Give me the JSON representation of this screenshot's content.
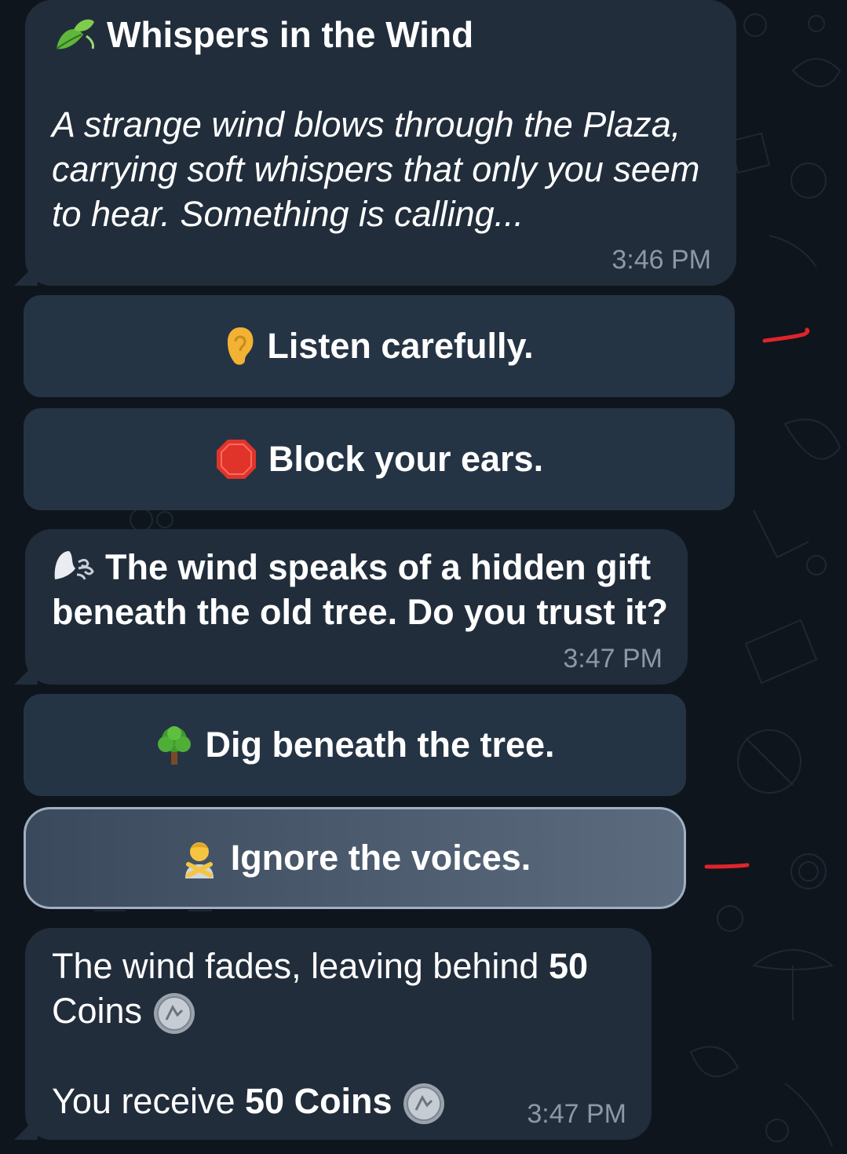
{
  "messages": [
    {
      "title": "Whispers in the Wind",
      "title_icon": "leaf-icon",
      "body": "A strange wind blows through the Plaza, carrying soft whispers that only you seem to hear. Something is calling...",
      "time": "3:46 PM"
    },
    {
      "text": "The wind speaks of a hidden gift beneath the old tree. Do you trust it?",
      "text_icon": "wind-face-icon",
      "time": "3:47 PM"
    },
    {
      "line1_prefix": "The wind fades, leaving behind ",
      "line1_amount": "50",
      "line1_unit": "Coins",
      "line2_prefix": "You receive ",
      "line2_amount": "50 Coins",
      "coin_icon": "coin-icon",
      "time": "3:47 PM"
    }
  ],
  "buttons_1": [
    {
      "label": "Listen carefully.",
      "icon": "ear-icon"
    },
    {
      "label": "Block your ears.",
      "icon": "stop-sign-icon"
    }
  ],
  "buttons_2": [
    {
      "label": "Dig beneath the tree.",
      "icon": "tree-icon"
    },
    {
      "label": "Ignore the voices.",
      "icon": "no-gesture-person-icon",
      "pressed": true
    }
  ],
  "colors": {
    "background": "#0e151d",
    "bubble": "#212d3b",
    "button": "#253445",
    "timestamp": "#8b98a7",
    "annotation": "#e0242b"
  }
}
